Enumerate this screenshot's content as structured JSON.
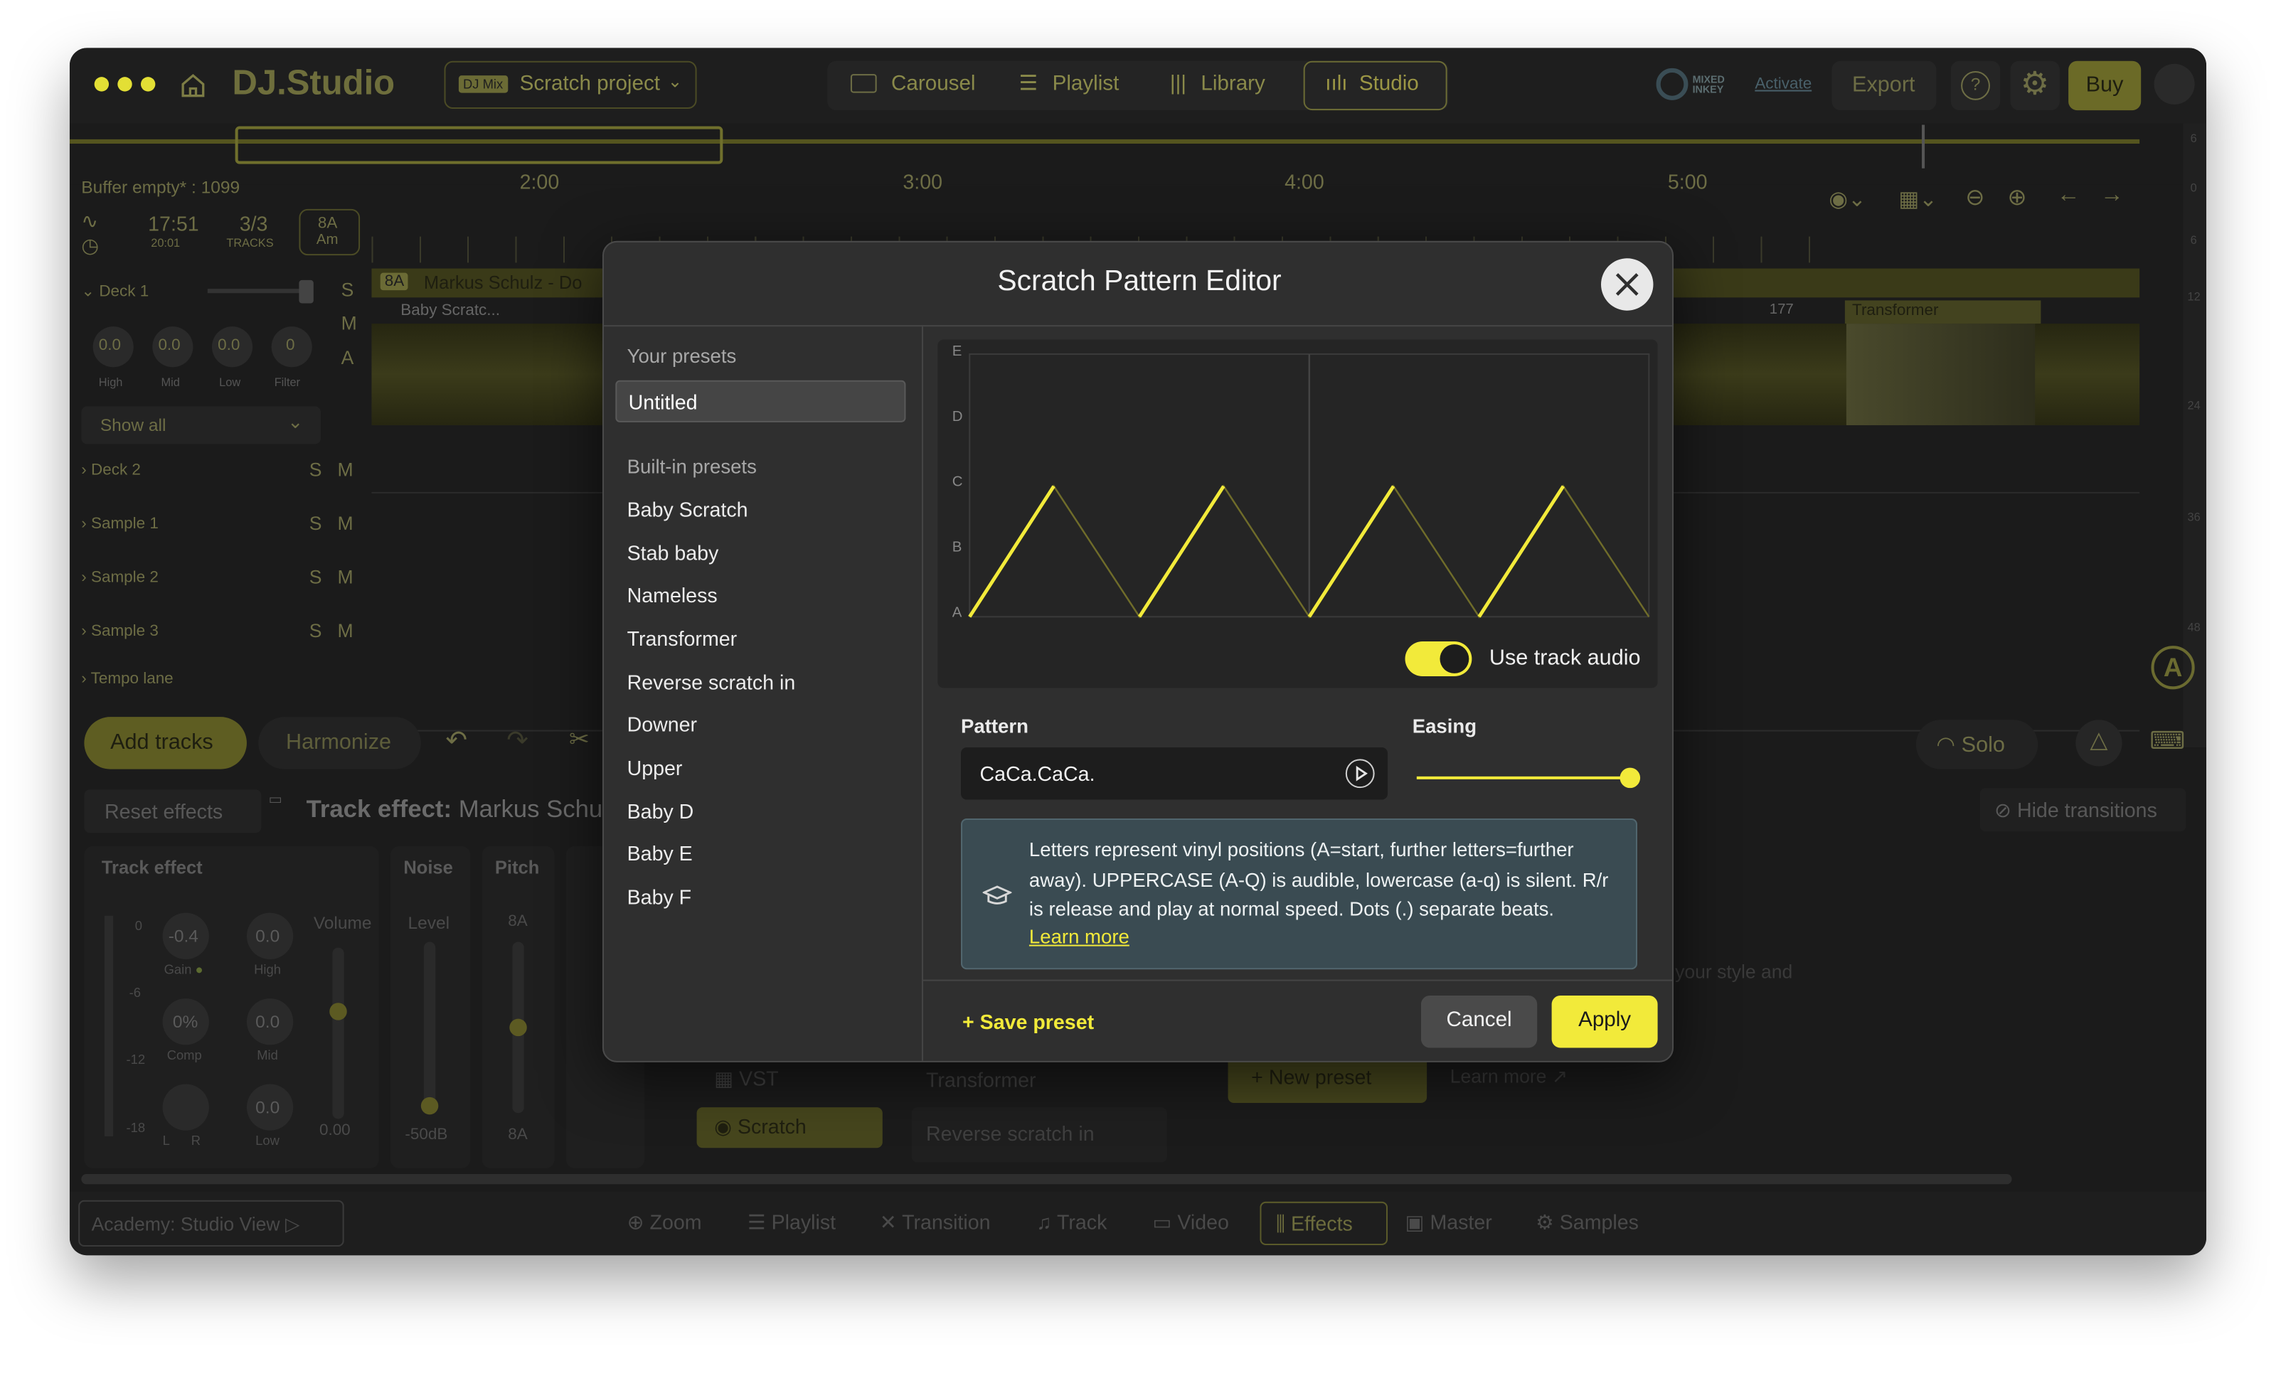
{
  "app": {
    "logo": "DJ.Studio",
    "project_badge": "DJ Mix",
    "project_name": "Scratch project",
    "nav_tabs": [
      "Carousel",
      "Playlist",
      "Library",
      "Studio"
    ],
    "mixed_inkey": "MIXED INKEY",
    "activate": "Activate",
    "export": "Export",
    "buy": "Buy"
  },
  "timeline": {
    "buffer": "Buffer empty* : 1099",
    "time": "17:51",
    "time_sub": "20:01",
    "tracks": "3/3",
    "tracks_label": "TRACKS",
    "key": "8A",
    "key_sub": "Am",
    "ticks": [
      "2:00",
      "3:00",
      "4:00",
      "5:00"
    ],
    "ruler_right": [
      "6",
      "0",
      "6",
      "12",
      "24",
      "36",
      "48"
    ]
  },
  "decks": {
    "deck1": "Deck 1",
    "knob_values": [
      "0.0",
      "0.0",
      "0.0",
      "0"
    ],
    "knob_labels": [
      "High",
      "Mid",
      "Low",
      "Filter"
    ],
    "show_all": "Show all",
    "rows": [
      "Deck 2",
      "Sample 1",
      "Sample 2",
      "Sample 3"
    ],
    "tempo": "Tempo lane",
    "s": "S",
    "m": "M",
    "a": "A"
  },
  "tracks": {
    "track_key": "8A",
    "track_name": "Markus Schulz - Do",
    "clip1": "Baby Scratc...",
    "clip2": "Transformer",
    "bar_num": "177"
  },
  "lower": {
    "add_tracks": "Add tracks",
    "harmonize": "Harmonize",
    "solo": "Solo",
    "reset_effects": "Reset effects",
    "track_effect_prefix": "Track effect:",
    "track_effect_name": "Markus Schu",
    "hide_transitions": "Hide transitions",
    "col_track_effect": "Track effect",
    "col_noise": "Noise",
    "col_pitch": "Pitch",
    "volume": "Volume",
    "level": "Level",
    "pitch_key": "8A",
    "db_marks": [
      "0",
      "-6",
      "-12",
      "-18"
    ],
    "fx_knobs": [
      {
        "value": "-0.4",
        "label": "Gain"
      },
      {
        "value": "0.0",
        "label": "High"
      },
      {
        "value": "0%",
        "label": "Comp"
      },
      {
        "value": "0.0",
        "label": "Mid"
      },
      {
        "value": "",
        "label": "L      R"
      },
      {
        "value": "0.0",
        "label": "Low"
      }
    ],
    "vol_value": "0.00",
    "noise_value": "-50dB",
    "pitch_value": "8A",
    "vst": "VST",
    "scratch": "Scratch",
    "transformer": "Transformer",
    "reverse": "Reverse scratch in",
    "new_preset": "New preset",
    "learn_more_bg": "Learn more",
    "style_text": "your style and"
  },
  "bottom_bar": {
    "academy": "Academy: Studio View",
    "items": [
      "Zoom",
      "Playlist",
      "Transition",
      "Track",
      "Video",
      "Effects",
      "Master",
      "Samples"
    ]
  },
  "modal": {
    "title": "Scratch Pattern Editor",
    "your_presets": "Your presets",
    "user_presets": [
      "Untitled"
    ],
    "builtin_label": "Built-in presets",
    "builtin_presets": [
      "Baby Scratch",
      "Stab baby",
      "Nameless",
      "Transformer",
      "Reverse scratch in",
      "Downer",
      "Upper",
      "Baby D",
      "Baby E",
      "Baby F"
    ],
    "y_labels": [
      "E",
      "D",
      "C",
      "B",
      "A"
    ],
    "use_track_audio": "Use track audio",
    "use_track_audio_on": true,
    "pattern_label": "Pattern",
    "pattern_value": "CaCa.CaCa.",
    "easing_label": "Easing",
    "easing_value": 1.0,
    "info_text": "Letters represent vinyl positions (A=start, further letters=further away). UPPERCASE (A-Q) is audible, lowercase (a-q) is silent. R/r is release and play at normal speed. Dots (.) separate beats.",
    "learn_more": "Learn more",
    "save_preset": "+ Save preset",
    "cancel": "Cancel",
    "apply": "Apply"
  },
  "colors": {
    "accent": "#f2ea3a",
    "accent_dim": "#8a8a4a",
    "modal_bg": "#2f2f2f"
  }
}
